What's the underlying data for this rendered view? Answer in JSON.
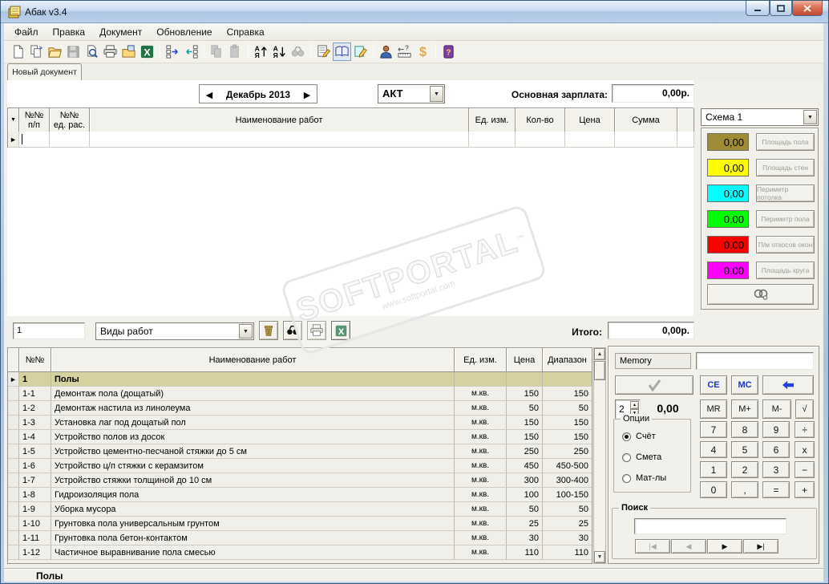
{
  "window": {
    "title": "Абак v3.4"
  },
  "menu": {
    "items": [
      "Файл",
      "Правка",
      "Документ",
      "Обновление",
      "Справка"
    ]
  },
  "toolbar": {
    "items": [
      {
        "icon": "new-document"
      },
      {
        "icon": "copy-document"
      },
      {
        "icon": "open-folder"
      },
      {
        "icon": "save",
        "disabled": true
      },
      {
        "icon": "print-preview"
      },
      {
        "icon": "print"
      },
      {
        "icon": "export-folder"
      },
      {
        "icon": "excel"
      },
      {
        "icon": "separator"
      },
      {
        "icon": "insert-row"
      },
      {
        "icon": "delete-row"
      },
      {
        "icon": "separator"
      },
      {
        "icon": "copy",
        "disabled": true
      },
      {
        "icon": "paste",
        "disabled": true
      },
      {
        "icon": "separator"
      },
      {
        "icon": "sort-asc"
      },
      {
        "icon": "sort-desc"
      },
      {
        "icon": "find",
        "disabled": true
      },
      {
        "icon": "separator"
      },
      {
        "icon": "properties"
      },
      {
        "icon": "reference-book",
        "pressed": true
      },
      {
        "icon": "edit-document"
      },
      {
        "icon": "separator"
      },
      {
        "icon": "client"
      },
      {
        "icon": "measure"
      },
      {
        "icon": "currency"
      },
      {
        "icon": "separator"
      },
      {
        "icon": "help"
      }
    ]
  },
  "tab": {
    "label": "Новый документ"
  },
  "doc_header": {
    "month": "Декабрь 2013",
    "doc_type": "АКТ",
    "salary_label": "Основная зарплата:",
    "salary_value": "0,00р.",
    "total_label": "Итого:",
    "total_value": "0,00р."
  },
  "main_table": {
    "headers": [
      "№№\nп/п",
      "№№\nед. рас.",
      "Наименование работ",
      "Ед. изм.",
      "Кол-во",
      "Цена",
      "Сумма"
    ]
  },
  "scheme_panel": {
    "selected": "Схема 1",
    "rows": [
      {
        "value": "0,00",
        "color": "#A08D33",
        "label": "Площадь пола"
      },
      {
        "value": "0,00",
        "color": "#FFFF00",
        "label": "Площадь стен"
      },
      {
        "value": "0,00",
        "color": "#00FFFF",
        "label": "Периметр потолка"
      },
      {
        "value": "0,00",
        "color": "#00FF00",
        "label": "Периметр пола"
      },
      {
        "value": "0,00",
        "color": "#FF0000",
        "label": "П/м откосов окон"
      },
      {
        "value": "0,00",
        "color": "#FF00FF",
        "label": "Площадь круга"
      }
    ],
    "link_icon": "link-icon"
  },
  "catalog_bar": {
    "number": "1",
    "category": "Виды работ",
    "buttons": [
      "trash-icon",
      "find-icon",
      "print-icon",
      "excel-icon"
    ]
  },
  "catalog_table": {
    "headers": [
      "№№",
      "Наименование работ",
      "Ед. изм.",
      "Цена",
      "Диапазон"
    ],
    "rows": [
      {
        "num": "1",
        "name": "Полы",
        "unit": "",
        "price": "",
        "range": "",
        "group": true,
        "current": true
      },
      {
        "num": "1-1",
        "name": "Демонтаж пола (дощатый)",
        "unit": "м.кв.",
        "price": "150",
        "range": "150"
      },
      {
        "num": "1-2",
        "name": "Демонтаж настила из линолеума",
        "unit": "м.кв.",
        "price": "50",
        "range": "50"
      },
      {
        "num": "1-3",
        "name": "Установка лаг под дощатый пол",
        "unit": "м.кв.",
        "price": "150",
        "range": "150"
      },
      {
        "num": "1-4",
        "name": "Устройство полов из досок",
        "unit": "м.кв.",
        "price": "150",
        "range": "150"
      },
      {
        "num": "1-5",
        "name": "Устройство цементно-песчаной стяжки до 5 см",
        "unit": "м.кв.",
        "price": "250",
        "range": "250"
      },
      {
        "num": "1-6",
        "name": "Устройство ц/п стяжки с керамзитом",
        "unit": "м.кв.",
        "price": "450",
        "range": "450-500"
      },
      {
        "num": "1-7",
        "name": "Устройство стяжки толщиной до 10 см",
        "unit": "м.кв.",
        "price": "300",
        "range": "300-400"
      },
      {
        "num": "1-8",
        "name": "Гидроизоляция пола",
        "unit": "м.кв.",
        "price": "100",
        "range": "100-150"
      },
      {
        "num": "1-9",
        "name": "Уборка мусора",
        "unit": "м.кв.",
        "price": "50",
        "range": "50"
      },
      {
        "num": "1-10",
        "name": "Грунтовка пола универсальным грунтом",
        "unit": "м.кв.",
        "price": "25",
        "range": "25"
      },
      {
        "num": "1-11",
        "name": "Грунтовка пола бетон-контактом",
        "unit": "м.кв.",
        "price": "30",
        "range": "30"
      },
      {
        "num": "1-12",
        "name": "Частичное выравнивание пола смесью",
        "unit": "м.кв.",
        "price": "110",
        "range": "110"
      }
    ]
  },
  "calculator": {
    "memory_label": "Memory",
    "memory_value": "",
    "precision": "2",
    "display": "0,00",
    "ce": "CE",
    "mc": "MC",
    "mr": "MR",
    "m_plus": "M+",
    "m_minus": "M-",
    "sqrt": "√",
    "keys": [
      [
        "7",
        "8",
        "9",
        "÷"
      ],
      [
        "4",
        "5",
        "6",
        "x"
      ],
      [
        "1",
        "2",
        "3",
        "−"
      ],
      [
        "0",
        ",",
        "=",
        "+"
      ]
    ],
    "options": {
      "title": "Опции",
      "items": [
        {
          "label": "Счёт",
          "selected": true
        },
        {
          "label": "Смета",
          "selected": false
        },
        {
          "label": "Мат-лы",
          "selected": false
        }
      ]
    }
  },
  "search": {
    "title": "Поиск",
    "value": "",
    "buttons": [
      {
        "label": "|◀",
        "disabled": true
      },
      {
        "label": "◀",
        "disabled": true
      },
      {
        "label": "▶",
        "disabled": false
      },
      {
        "label": "▶|",
        "disabled": false
      }
    ]
  },
  "status_bar": {
    "text": "Полы"
  },
  "watermark": {
    "text": "SOFTPORTAL",
    "tm": "™",
    "url": "www.softportal.com"
  }
}
